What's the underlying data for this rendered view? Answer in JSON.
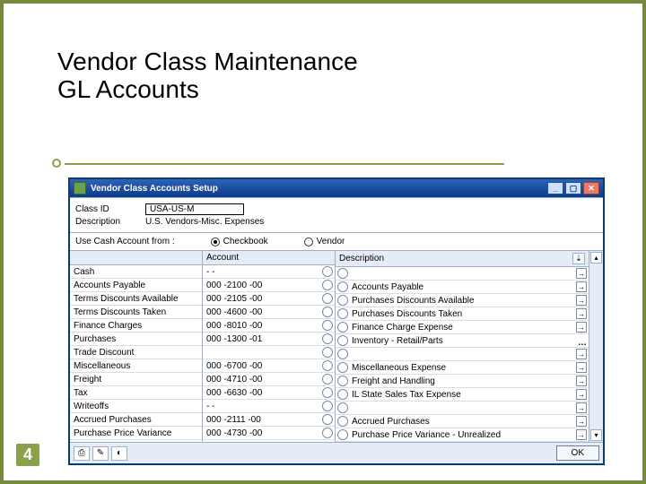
{
  "slide": {
    "title_line1": "Vendor Class Maintenance",
    "title_line2": "GL Accounts",
    "number": "4"
  },
  "window": {
    "title": "Vendor Class Accounts Setup"
  },
  "header": {
    "class_id_label": "Class ID",
    "class_id": "USA-US-M",
    "description_label": "Description",
    "description": "U.S. Vendors-Misc. Expenses"
  },
  "cash": {
    "label": "Use Cash Account from :",
    "option_checkbook": "Checkbook",
    "option_vendor": "Vendor",
    "selected": "Checkbook"
  },
  "grid": {
    "account_header": "Account",
    "description_header": "Description"
  },
  "rows": [
    {
      "type": "Cash",
      "account": "   -      -",
      "desc": ""
    },
    {
      "type": "Accounts Payable",
      "account": "000 -2100 -00",
      "desc": "Accounts Payable"
    },
    {
      "type": "Terms Discounts Available",
      "account": "000 -2105 -00",
      "desc": "Purchases Discounts Available"
    },
    {
      "type": "Terms Discounts Taken",
      "account": "000 -4600 -00",
      "desc": "Purchases Discounts Taken"
    },
    {
      "type": "Finance Charges",
      "account": "000 -8010 -00",
      "desc": "Finance Charge Expense"
    },
    {
      "type": "Purchases",
      "account": "000 -1300 -01",
      "desc": "Inventory - Retail/Parts"
    },
    {
      "type": "Trade Discount",
      "account": "",
      "desc": ""
    },
    {
      "type": "Miscellaneous",
      "account": "000 -6700 -00",
      "desc": "Miscellaneous Expense"
    },
    {
      "type": "Freight",
      "account": "000 -4710 -00",
      "desc": "Freight and Handling"
    },
    {
      "type": "Tax",
      "account": "000 -6630 -00",
      "desc": "IL State Sales Tax Expense"
    },
    {
      "type": "Writeoffs",
      "account": "   -      -",
      "desc": ""
    },
    {
      "type": "Accrued Purchases",
      "account": "000 -2111 -00",
      "desc": "Accrued Purchases"
    },
    {
      "type": "Purchase Price Variance",
      "account": "000 -4730 -00",
      "desc": "Purchase Price Variance - Unrealized"
    }
  ],
  "footer": {
    "ok": "OK"
  }
}
